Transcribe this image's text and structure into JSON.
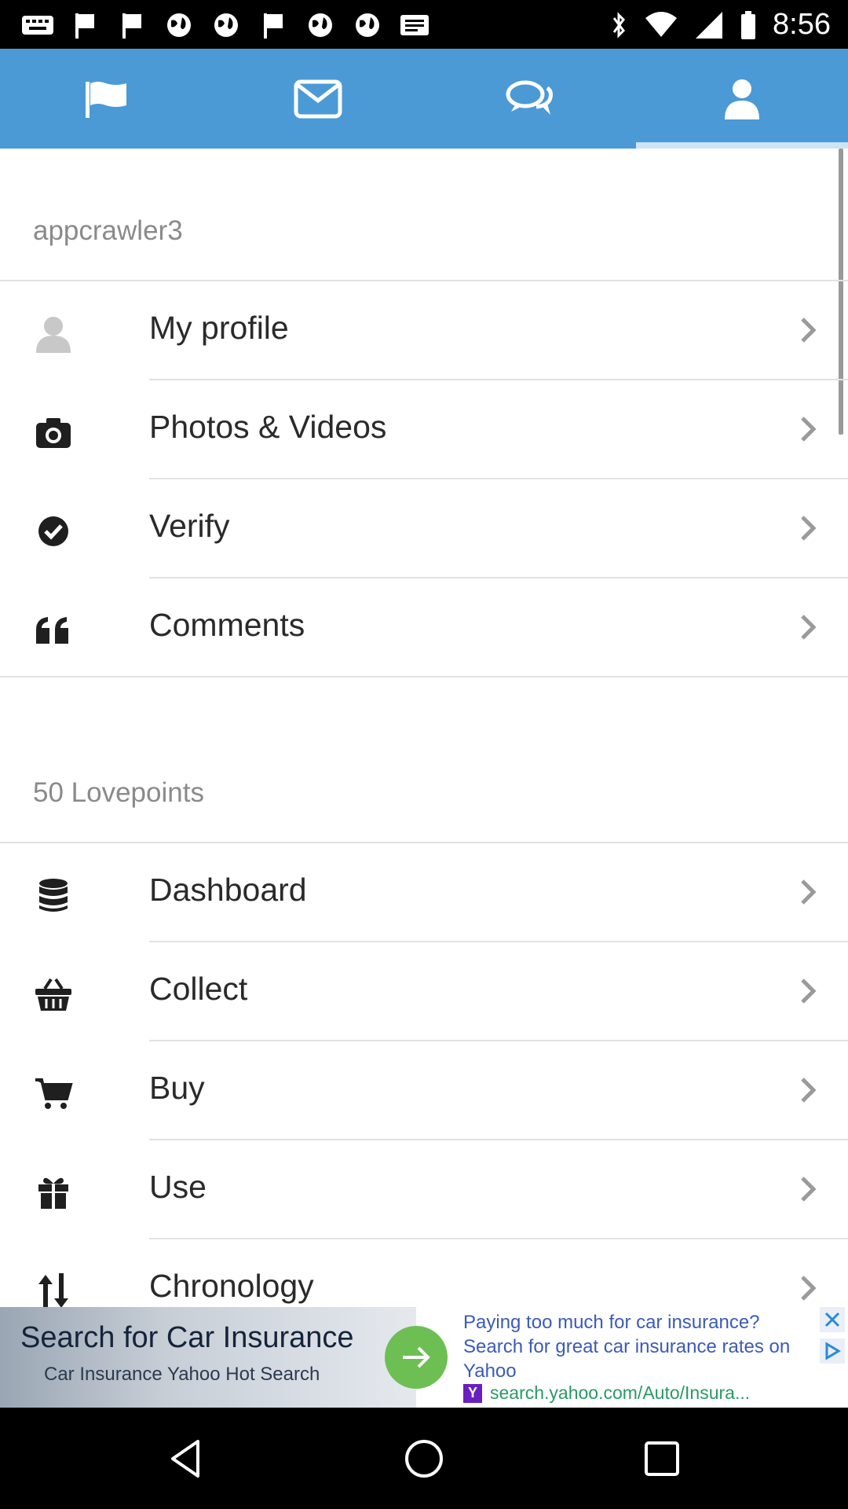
{
  "status_bar": {
    "time": "8:56",
    "notification_icons": [
      "keyboard-icon",
      "flag-icon",
      "flag-icon",
      "globe-icon",
      "globe-icon",
      "flag-icon",
      "globe-icon",
      "globe-icon",
      "message-icon"
    ],
    "system_icons": [
      "bluetooth-icon",
      "wifi-icon",
      "signal-icon",
      "battery-icon"
    ]
  },
  "tabs": [
    {
      "icon": "flag-icon",
      "active": false
    },
    {
      "icon": "envelope-icon",
      "active": false
    },
    {
      "icon": "chat-bubbles-icon",
      "active": false
    },
    {
      "icon": "user-icon",
      "active": true
    }
  ],
  "account": {
    "username": "appcrawler3",
    "items": [
      {
        "label": "My profile",
        "icon": "profile-silhouette-icon"
      },
      {
        "label": "Photos & Videos",
        "icon": "camera-icon"
      },
      {
        "label": "Verify",
        "icon": "check-circle-icon"
      },
      {
        "label": "Comments",
        "icon": "quote-icon"
      }
    ]
  },
  "lovepoints": {
    "header": "50 Lovepoints",
    "items": [
      {
        "label": "Dashboard",
        "icon": "coin-stack-icon"
      },
      {
        "label": "Collect",
        "icon": "basket-icon"
      },
      {
        "label": "Buy",
        "icon": "cart-icon"
      },
      {
        "label": "Use",
        "icon": "gift-icon"
      },
      {
        "label": "Chronology",
        "icon": "sort-arrows-icon"
      }
    ]
  },
  "ad": {
    "title": "Search for Car Insurance",
    "subtitle": "Car Insurance Yahoo Hot Search",
    "text": "Paying too much for car insurance? Search for great car insurance rates on Yahoo",
    "badge": "Y",
    "url": "search.yahoo.com/Auto/Insura..."
  },
  "colors": {
    "tabbar": "#4b9ad6",
    "accent_green": "#6dbf54",
    "link_green": "#2a9a64"
  }
}
